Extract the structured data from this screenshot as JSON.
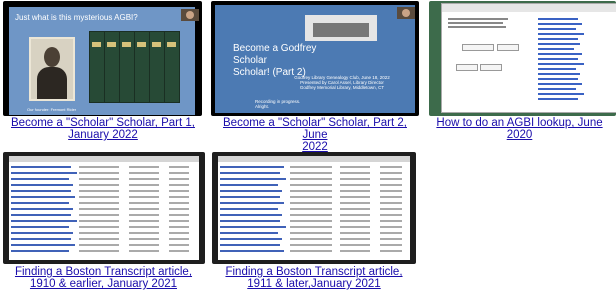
{
  "videos": [
    {
      "caption_lines": [
        "Become a \"Scholar\" Scholar, Part 1,",
        "January 2022"
      ],
      "slide_headline": "Just what is this mysterious AGBI?",
      "slide_caption": "Our founder: Fremont Rider"
    },
    {
      "caption_lines": [
        "Become a \"Scholar\" Scholar, Part 2, June",
        "2022"
      ],
      "slide_title_lines": [
        "Become a Godfrey Scholar",
        "Scholar! (Part 2)"
      ],
      "slide_sub_lines": [
        "Godfrey Library Genealogy Club, June 18, 2022",
        "Presented by Carol Assel, Library Director",
        "Godfrey Memorial Library, Middletown, CT"
      ],
      "slide_recording": [
        "Recording in progress.",
        "Alright."
      ]
    },
    {
      "caption_lines": [
        "How to do an AGBI lookup, June 2020"
      ]
    },
    {
      "caption_lines": [
        "Finding a Boston Transcript article,",
        "1910 & earlier, January 2021"
      ]
    },
    {
      "caption_lines": [
        "Finding a Boston Transcript article,",
        "1911 & later,January 2021"
      ]
    }
  ]
}
